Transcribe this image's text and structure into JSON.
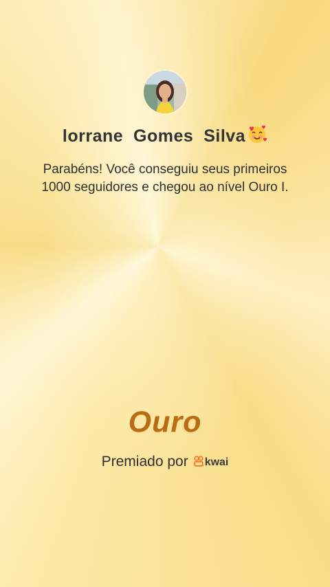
{
  "user": {
    "name": "lorrane  Gomes  Silva",
    "emoji_icon": "smiling-face-with-hearts-icon"
  },
  "message": "Parabéns! Você conseguiu seus primeiros 1000 seguidores e chegou ao nível Ouro I.",
  "level": {
    "name": "Ouro"
  },
  "award": {
    "prefix": "Premiado por",
    "brand_name": "kwai",
    "brand_icon": "kwai-logo-icon",
    "brand_color": "#ff6a1a"
  },
  "colors": {
    "level_text": "#b86c14",
    "background_gold": "#f9dc85"
  }
}
